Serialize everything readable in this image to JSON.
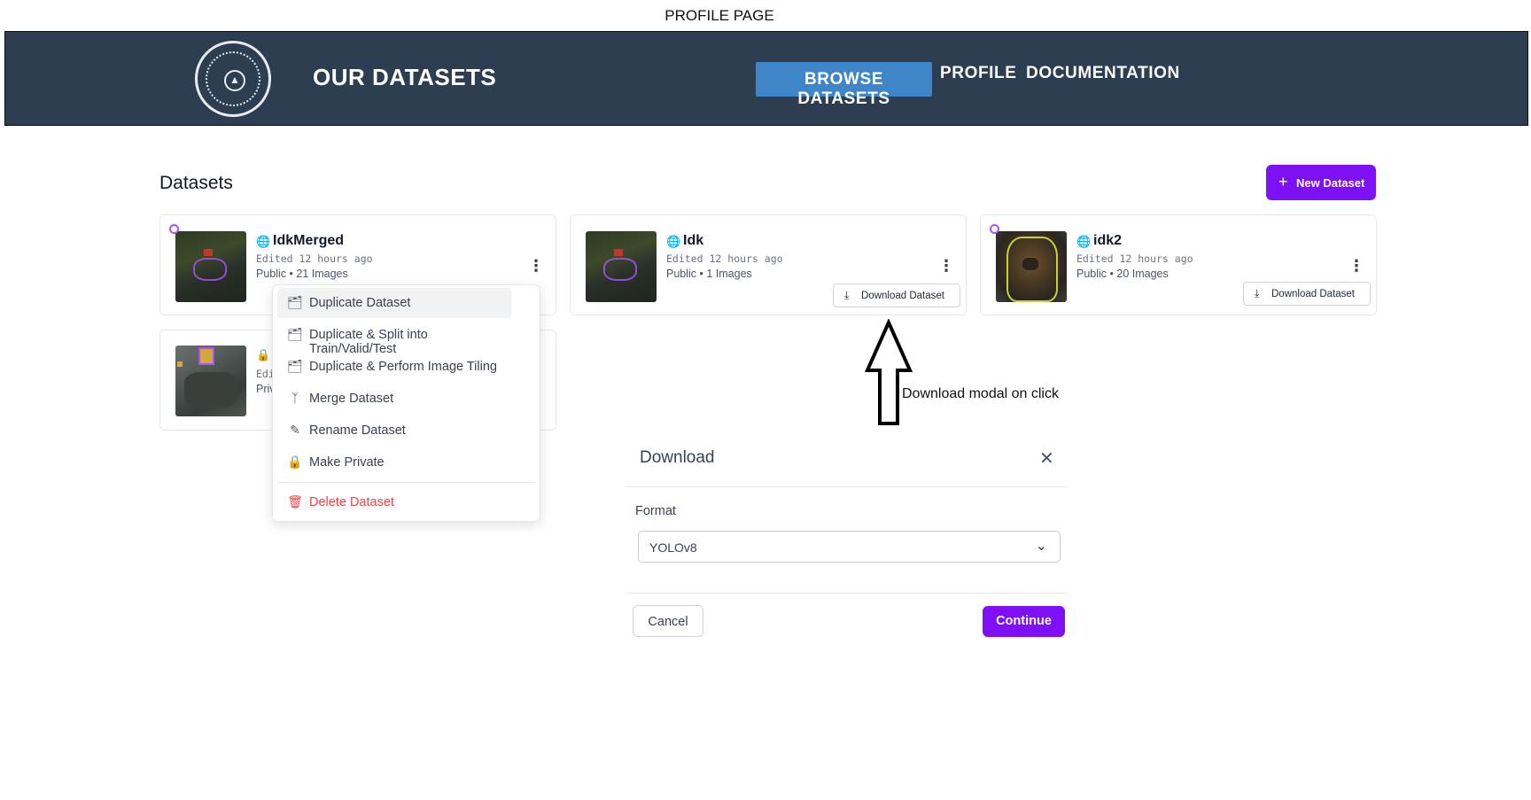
{
  "page_caption": "PROFILE PAGE",
  "header": {
    "title": "OUR DATASETS",
    "logo_icon": "university-seal-icon",
    "nav": [
      {
        "label": "BROWSE DATASETS",
        "active": true
      },
      {
        "label": "PROFILE",
        "active": false
      },
      {
        "label": "DOCUMENTATION",
        "active": false
      }
    ],
    "colors": {
      "bar": "#2d3d52",
      "active_nav": "#3f86c9"
    }
  },
  "main": {
    "heading": "Datasets",
    "new_dataset_label": "New Dataset",
    "accent": "#7e10f5"
  },
  "cards": [
    {
      "title": "IdkMerged",
      "edited": "Edited 12 hours ago",
      "visibility": "Public",
      "images": "21 Images",
      "sub": "Public • 21 Images",
      "icon": "globe-icon"
    },
    {
      "title": "Idk",
      "edited": "Edited 12 hours ago",
      "visibility": "Public",
      "images": "1 Images",
      "sub": "Public • 1 Images",
      "icon": "globe-icon",
      "download_label": "Download Dataset"
    },
    {
      "title": "idk2",
      "edited": "Edited 12 hours ago",
      "visibility": "Public",
      "images": "20 Images",
      "sub": "Public • 20 Images",
      "icon": "globe-icon",
      "download_label": "Download Dataset"
    },
    {
      "title": "",
      "edited": "Edi",
      "visibility": "Priv",
      "sub": "Priv",
      "icon": "lock-icon"
    }
  ],
  "menu": {
    "items": [
      {
        "label": "Duplicate Dataset",
        "icon": "folders-icon"
      },
      {
        "label": "Duplicate & Split into Train/Valid/Test",
        "icon": "folders-icon"
      },
      {
        "label": "Duplicate & Perform Image Tiling",
        "icon": "folders-icon"
      },
      {
        "label": "Merge Dataset",
        "icon": "git-merge-icon"
      },
      {
        "label": "Rename Dataset",
        "icon": "pencil-icon"
      },
      {
        "label": "Make Private",
        "icon": "lock-icon"
      }
    ],
    "danger_item": {
      "label": "Delete Dataset",
      "icon": "trash-icon",
      "color": "#ef4444"
    }
  },
  "annotation": {
    "text": "Download modal on click"
  },
  "modal": {
    "title": "Download",
    "format_label": "Format",
    "format_value": "YOLOv8",
    "cancel_label": "Cancel",
    "continue_label": "Continue"
  }
}
